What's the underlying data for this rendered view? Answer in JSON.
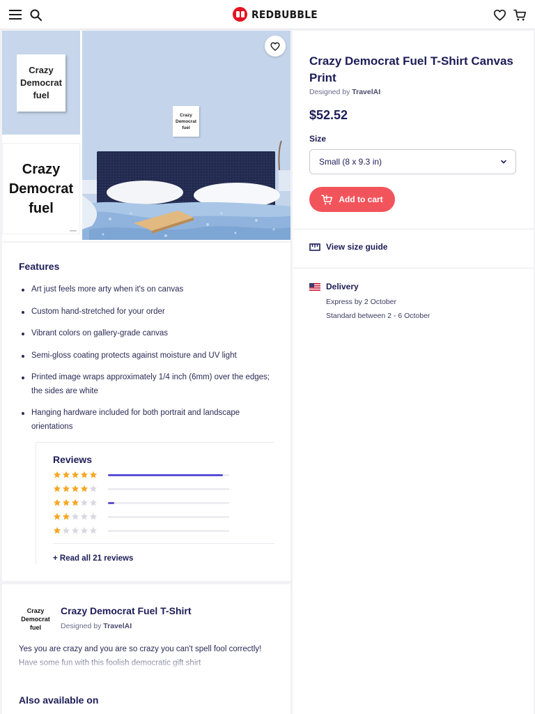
{
  "header": {
    "logo_text": "REDBUBBLE",
    "icons": [
      "menu-icon",
      "search-icon",
      "heart-icon",
      "cart-icon"
    ]
  },
  "gallery": {
    "thumb1_text": "Crazy Democrat fuel",
    "thumb2_text": "Crazy Democrat fuel",
    "main_canvas_text": "Crazy Democrat fuel"
  },
  "product": {
    "title": "Crazy Democrat Fuel T-Shirt Canvas Print",
    "designed_by_prefix": "Designed by",
    "designer": "TravelAI",
    "price": "$52.52",
    "size_label": "Size",
    "size_value": "Small (8 x 9.3 in)",
    "add_to_cart": "Add to cart",
    "size_guide": "View size guide"
  },
  "delivery": {
    "title": "Delivery",
    "express": "Express by 2 October",
    "standard": "Standard between 2 - 6 October"
  },
  "features": {
    "title": "Features",
    "items": [
      "Art just feels more arty when it's on canvas",
      "Custom hand-stretched for your order",
      "Vibrant colors on gallery-grade canvas",
      "Semi-gloss coating protects against moisture and UV light",
      "Printed image wraps approximately 1/4 inch (6mm) over the edges; the sides are white",
      "Hanging hardware included for both portrait and landscape orientations"
    ]
  },
  "reviews": {
    "title": "Reviews",
    "distribution": [
      {
        "stars": 5,
        "fraction": 0.95
      },
      {
        "stars": 4,
        "fraction": 0.0
      },
      {
        "stars": 3,
        "fraction": 0.05
      },
      {
        "stars": 2,
        "fraction": 0.0
      },
      {
        "stars": 1,
        "fraction": 0.0
      }
    ],
    "read_all": "+ Read all 21 reviews"
  },
  "design": {
    "thumb_text": "Crazy Democrat fuel",
    "title": "Crazy Democrat Fuel T-Shirt",
    "designed_by_prefix": "Designed by",
    "designer": "TravelAI",
    "description": "Yes you are crazy and you are so crazy you can't spell fool correctly! Have some fun with this foolish democratic gift shirt",
    "also_available": "Also available on"
  },
  "colors": {
    "accent": "#f2545b",
    "brand_red": "#e41321",
    "navy": "#1c1c57",
    "review_bar": "#5b4fd6",
    "star": "#f5a623"
  }
}
